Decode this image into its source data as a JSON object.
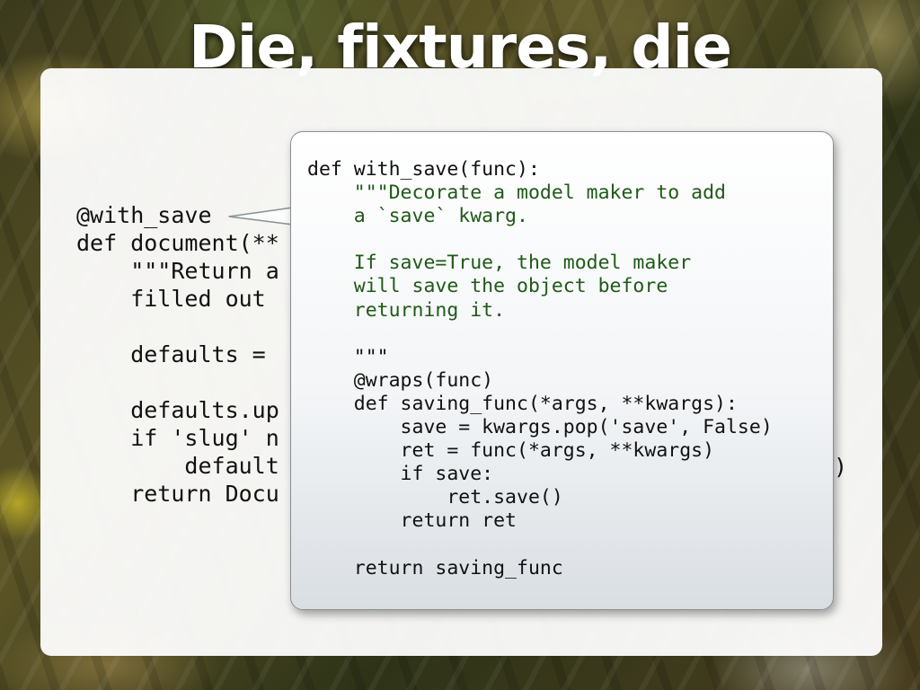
{
  "slide": {
    "title": "Die, fixtures, die"
  },
  "main_code": {
    "lines": [
      "@with_save",
      "def document(**",
      "    \"\"\"Return a",
      "    filled out",
      "",
      "    defaults =",
      "",
      "    defaults.up",
      "    if 'slug' n",
      "        default",
      "    return Docu"
    ],
    "trailing_fragment": ")"
  },
  "callout": {
    "lines": [
      "def with_save(func):",
      "    \"\"\"Decorate a model maker to add",
      "    a `save` kwarg.",
      "",
      "    If save=True, the model maker",
      "    will save the object before",
      "    returning it.",
      "",
      "    \"\"\"",
      "    @wraps(func)",
      "    def saving_func(*args, **kwargs):",
      "        save = kwargs.pop('save', False)",
      "        ret = func(*args, **kwargs)",
      "        if save:",
      "            ret.save()",
      "        return ret",
      "",
      "    return saving_func"
    ]
  },
  "colors": {
    "code_text": "#111111",
    "docstring": "#1f5a17",
    "title_text": "#ffffff",
    "panel": "#ffffff"
  }
}
